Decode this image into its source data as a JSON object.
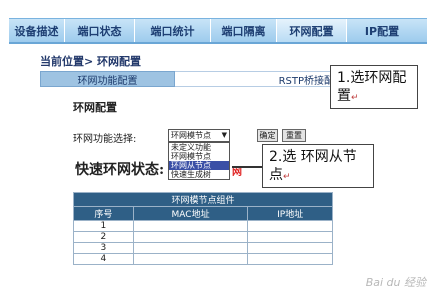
{
  "nav": {
    "items": [
      "设备描述",
      "端口状态",
      "端口统计",
      "端口隔离",
      "环网配置",
      "IP配置"
    ]
  },
  "breadcrumb": "当前位置> 环网配置",
  "subtabs": {
    "active": "环网功能配置",
    "inactive": "RSTP桥接配"
  },
  "section_title": "环网配置",
  "form": {
    "function_label": "环网功能选择:",
    "selected_value": "环网模节点",
    "options": [
      "未定义功能",
      "环网模节点",
      "环网从节点",
      "快速生成树"
    ],
    "selected_index": 2,
    "ok_label": "确定",
    "cancel_label": "重置"
  },
  "status": {
    "label": "快速环网状态:",
    "tail": "网"
  },
  "table": {
    "caption": "环网模节点组件",
    "headers": [
      "序号",
      "MAC地址",
      "IP地址"
    ],
    "rows": [
      [
        "1",
        "",
        ""
      ],
      [
        "2",
        "",
        ""
      ],
      [
        "3",
        "",
        ""
      ],
      [
        "4",
        "",
        ""
      ]
    ]
  },
  "callouts": {
    "c1": "1.选环网配置",
    "c2": "2.选 环网从节点",
    "return_mark": "↵"
  },
  "watermark": "Bai du 经验",
  "colors": {
    "nav_bg": "#9dcbed",
    "table_header": "#2f5f86",
    "selected_option": "#3a4fa6",
    "alert_red": "#e02020"
  }
}
